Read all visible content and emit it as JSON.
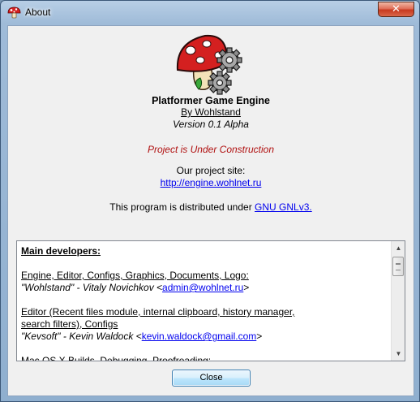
{
  "window": {
    "title": "About",
    "close_glyph": "✕"
  },
  "about": {
    "app_name": "Platformer Game Engine",
    "author": "By Wohlstand",
    "version": "Version 0.1 Alpha",
    "construction": "Project is Under Construction",
    "site_label": "Our project site:",
    "site_url": "http://engine.wohlnet.ru",
    "license_prefix": "This program is distributed under ",
    "license_link": "GNU GNLv3."
  },
  "credits": {
    "heading": "Main developers:",
    "dev1_role": "Engine, Editor, Configs, Graphics, Documents, Logo:",
    "dev1_name": "\"Wohlstand\" - Vitaly Novichkov <",
    "dev1_email": "admin@wohlnet.ru",
    "dev1_close": ">",
    "dev2_role_line1": "Editor (Recent files module, internal clipboard, history manager,",
    "dev2_role_line2": "search filters), Configs",
    "dev2_name": "\"Kevsoft\" - Kevin Waldock <",
    "dev2_email": "kevin.waldock@gmail.com",
    "dev2_close": ">",
    "dev3_role": "Mac OS X Builds, Debugging, Proofreading:"
  },
  "buttons": {
    "close_label": "Close"
  },
  "icons": {
    "app_icon": "mushroom-icon",
    "logo": "mushroom-gears-logo",
    "scroll_up": "▲",
    "scroll_down": "▼"
  },
  "colors": {
    "link": "#0000ee",
    "construction": "#b01010",
    "mushroom_cap": "#d42020"
  }
}
